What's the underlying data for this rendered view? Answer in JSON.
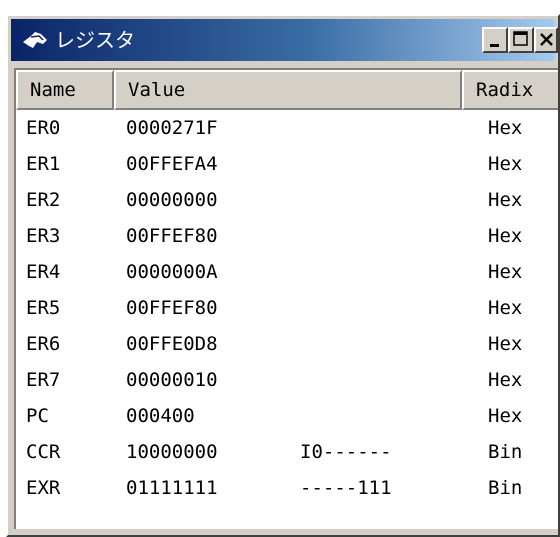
{
  "window": {
    "title": "レジスタ"
  },
  "titlebar_buttons": [
    {
      "name": "minimize-button",
      "icon": "minimize-icon"
    },
    {
      "name": "maximize-button",
      "icon": "maximize-icon"
    },
    {
      "name": "close-button",
      "icon": "close-icon"
    }
  ],
  "table": {
    "columns": [
      "Name",
      "Value",
      "Radix"
    ],
    "rows": [
      {
        "name": "ER0",
        "value": "0000271F",
        "flags": "",
        "radix": "Hex"
      },
      {
        "name": "ER1",
        "value": "00FFEFA4",
        "flags": "",
        "radix": "Hex"
      },
      {
        "name": "ER2",
        "value": "00000000",
        "flags": "",
        "radix": "Hex"
      },
      {
        "name": "ER3",
        "value": "00FFEF80",
        "flags": "",
        "radix": "Hex"
      },
      {
        "name": "ER4",
        "value": "0000000A",
        "flags": "",
        "radix": "Hex"
      },
      {
        "name": "ER5",
        "value": "00FFEF80",
        "flags": "",
        "radix": "Hex"
      },
      {
        "name": "ER6",
        "value": "00FFE0D8",
        "flags": "",
        "radix": "Hex"
      },
      {
        "name": "ER7",
        "value": "00000010",
        "flags": "",
        "radix": "Hex"
      },
      {
        "name": "PC",
        "value": "000400",
        "flags": "",
        "radix": "Hex"
      },
      {
        "name": "CCR",
        "value": "10000000",
        "flags": "I0------",
        "radix": "Bin"
      },
      {
        "name": "EXR",
        "value": "01111111",
        "flags": "-----111",
        "radix": "Bin"
      }
    ]
  },
  "colors": {
    "title_gradient_start": "#0a246a",
    "title_gradient_end": "#a6caf0",
    "face": "#d4d0c8"
  }
}
